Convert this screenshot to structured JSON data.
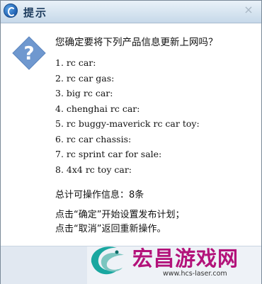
{
  "window": {
    "title": "提示",
    "close_glyph": "×"
  },
  "dialog": {
    "icon": "question-icon",
    "prompt": "您确定要将下列产品信息更新上网吗？",
    "items": [
      "1. rc car:",
      "2. rc car gas:",
      "3. big rc car:",
      "4. chenghai rc car:",
      "5. rc buggy-maverick rc car toy:",
      "6. rc car chassis:",
      "7. rc sprint car for sale:",
      "8. 4x4 rc toy car:"
    ],
    "summary": "总计可操作信息：8条",
    "instruction_1": "点击“确定”开始设置发布计划；",
    "instruction_2": "点击“取消”返回重新操作。"
  },
  "watermark": {
    "title": "宏昌游戏网",
    "url": "www.hcs-laser.com"
  },
  "colors": {
    "accent": "#1f5fb0",
    "question_icon": "#6f98cf",
    "watermark_title": "#b3127a",
    "watermark_logo": "#19a7a0"
  }
}
